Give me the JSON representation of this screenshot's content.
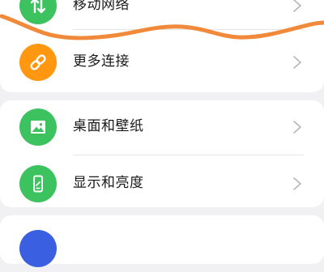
{
  "colors": {
    "green_icon": "#3cc25e",
    "orange_icon": "#ff9711",
    "blue_icon": "#3a5fe0",
    "annotation": "#f08a3a",
    "page_background": "#f1f1f3"
  },
  "settings": {
    "groups": [
      {
        "items": [
          {
            "label": "移动网络",
            "icon": "arrows-updown-icon"
          },
          {
            "label": "更多连接",
            "icon": "link-icon"
          }
        ]
      },
      {
        "items": [
          {
            "label": "桌面和壁纸",
            "icon": "image-icon"
          },
          {
            "label": "显示和亮度",
            "icon": "phone-display-icon"
          }
        ]
      },
      {
        "items": [
          {
            "label": "",
            "icon": "blue-settings-icon"
          }
        ]
      }
    ]
  },
  "annotation": {
    "type": "hand-drawn-underline"
  }
}
